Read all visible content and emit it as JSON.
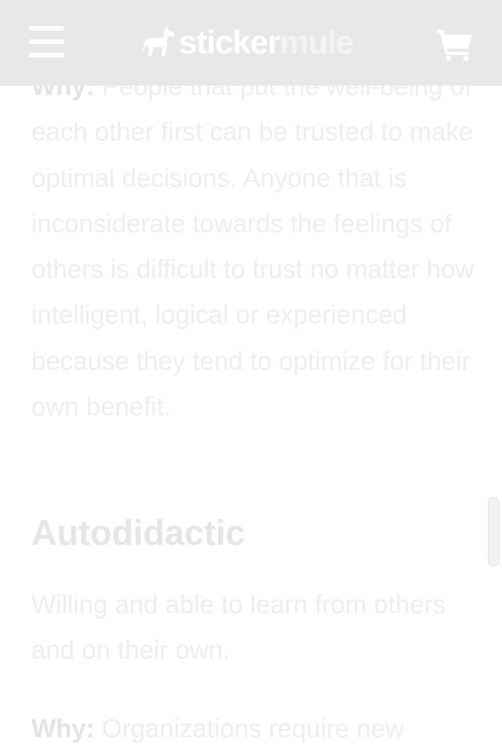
{
  "header": {
    "logo_part1": "sticker",
    "logo_part2": "mule",
    "menu_icon": "hamburger-menu-icon",
    "cart_icon": "shopping-cart-icon",
    "background": "#e8e8e8"
  },
  "article": {
    "why_label_1": "Why:",
    "para1_rest": " People that put the well-being of each other first can be trusted to make optimal decisions. Anyone that is inconsiderate towards the feelings of others is difficult to trust no matter how intelligent, logical or experienced because they tend to optimize for their own benefit.",
    "heading": "Autodidactic",
    "para2": "Willing and able to learn from others and on their own.",
    "why_label_2": "Why:",
    "para3_rest": " Organizations require new"
  }
}
